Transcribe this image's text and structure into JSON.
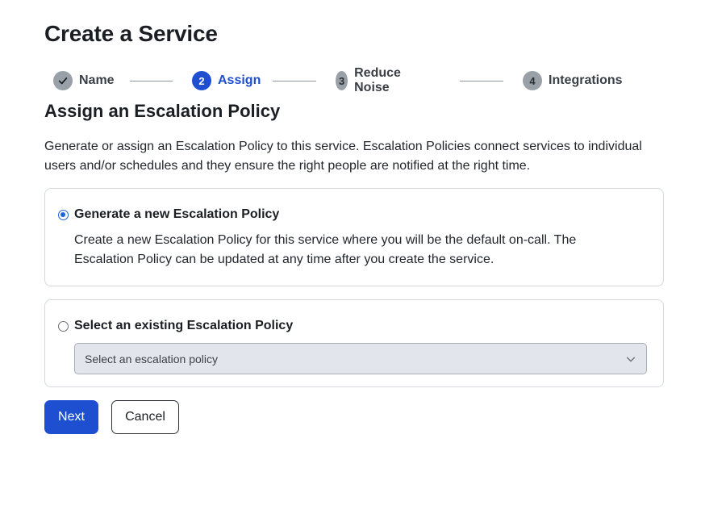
{
  "page": {
    "title": "Create a Service"
  },
  "stepper": {
    "steps": [
      {
        "number": "",
        "label": "Name",
        "state": "done"
      },
      {
        "number": "2",
        "label": "Assign",
        "state": "active"
      },
      {
        "number": "3",
        "label": "Reduce Noise",
        "state": "pending"
      },
      {
        "number": "4",
        "label": "Integrations",
        "state": "pending"
      }
    ]
  },
  "section": {
    "title": "Assign an Escalation Policy",
    "description": "Generate or assign an Escalation Policy to this service. Escalation Policies connect services to individual users and/or schedules and they ensure the right people are notified at the right time."
  },
  "options": {
    "generate": {
      "label": "Generate a new Escalation Policy",
      "selected": true,
      "description": "Create a new Escalation Policy for this service where you will be the default on-call. The Escalation Policy can be updated at any time after you create the service."
    },
    "existing": {
      "label": "Select an existing Escalation Policy",
      "selected": false,
      "select_value": "Select an escalation policy"
    }
  },
  "actions": {
    "next_label": "Next",
    "cancel_label": "Cancel"
  },
  "colors": {
    "primary": "#1f4fd1",
    "radio": "#1f63d6",
    "select_bg": "#e2e6ec"
  }
}
